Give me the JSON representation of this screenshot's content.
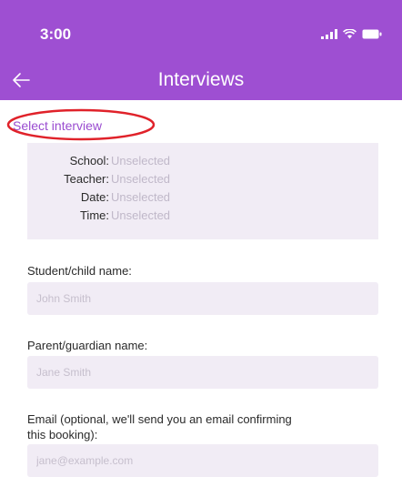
{
  "status_bar": {
    "time": "3:00"
  },
  "header": {
    "title": "Interviews"
  },
  "select_interview": {
    "label": "Select interview"
  },
  "summary": [
    {
      "key": "School:",
      "value": "Unselected"
    },
    {
      "key": "Teacher:",
      "value": "Unselected"
    },
    {
      "key": "Date:",
      "value": "Unselected"
    },
    {
      "key": "Time:",
      "value": "Unselected"
    }
  ],
  "form": {
    "student": {
      "label": "Student/child name:",
      "placeholder": "John Smith",
      "value": ""
    },
    "parent": {
      "label": "Parent/guardian name:",
      "placeholder": "Jane Smith",
      "value": ""
    },
    "email": {
      "label_line1": "Email (optional, we'll send you an email confirming",
      "label_line2": "this booking):",
      "placeholder": "jane@example.com",
      "value": ""
    }
  },
  "colors": {
    "accent": "#9e4fd2",
    "annotation": "#e0222a",
    "field_bg": "#f1ecf5"
  },
  "icons": [
    "back-arrow-icon",
    "signal-icon",
    "wifi-icon",
    "battery-icon"
  ]
}
